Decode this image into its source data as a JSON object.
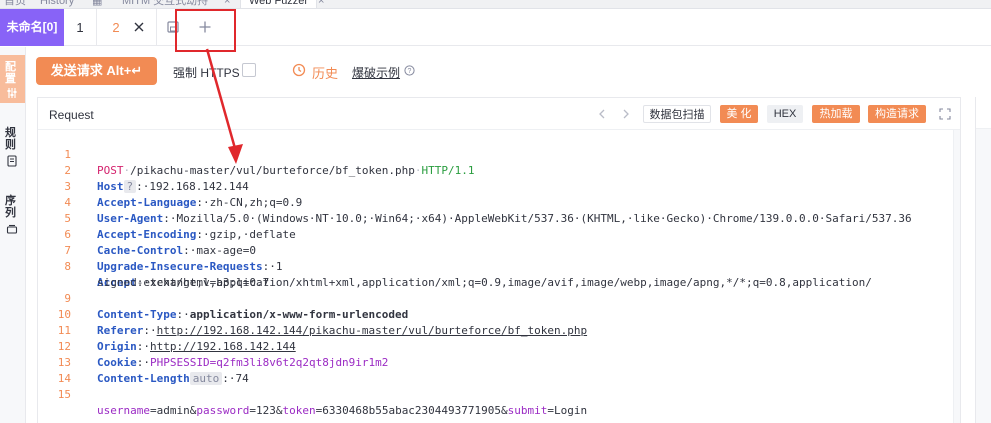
{
  "top_tabs": [
    {
      "label": "首页"
    },
    {
      "label": "History"
    },
    {
      "label": "MITM 交互式劫持"
    },
    {
      "label": "Web Fuzzer"
    }
  ],
  "tab_group": {
    "name": "未命名[0]",
    "tabs": [
      {
        "label": "1"
      },
      {
        "label": "2"
      }
    ]
  },
  "sidebar": {
    "items": [
      {
        "label": "配置"
      },
      {
        "label": "规则"
      },
      {
        "label": "序列"
      }
    ]
  },
  "toolbar": {
    "send_label": "发送请求 Alt+↵",
    "force_https_label": "强制 HTTPS",
    "history_label": "历史",
    "example_label": "爆破示例"
  },
  "request_panel": {
    "title": "Request",
    "buttons": {
      "scan": "数据包扫描",
      "beautify": "美 化",
      "hex": "HEX",
      "hot_load": "热加载",
      "build": "构造请求"
    }
  },
  "code": {
    "l1": {
      "num": "1",
      "method": "POST",
      "path": "/pikachu-master/vul/burteforce/bf_token.php",
      "proto": "HTTP/1.1"
    },
    "l2": {
      "num": "2",
      "name": "Host",
      "chip": "?",
      "value": "192.168.142.144"
    },
    "l3": {
      "num": "3",
      "name": "Accept-Language",
      "value": "zh-CN,zh;q=0.9"
    },
    "l4": {
      "num": "4",
      "name": "User-Agent",
      "value": "Mozilla/5.0·(Windows·NT·10.0;·Win64;·x64)·AppleWebKit/537.36·(KHTML,·like·Gecko)·Chrome/139.0.0.0·Safari/537.36"
    },
    "l5": {
      "num": "5",
      "name": "Accept-Encoding",
      "value": "gzip,·deflate"
    },
    "l6": {
      "num": "6",
      "name": "Cache-Control",
      "value": "max-age=0"
    },
    "l7": {
      "num": "7",
      "name": "Upgrade-Insecure-Requests",
      "value": "1"
    },
    "l8": {
      "num": "8",
      "name": "Accept",
      "value": "text/html,application/xhtml+xml,application/xml;q=0.9,image/avif,image/webp,image/apng,*/*;q=0.8,application/",
      "cont": "signed-exchange;v=b3;q=0.7"
    },
    "l9": {
      "num": "9",
      "name": "Content-Type",
      "value": "application/x-www-form-urlencoded"
    },
    "l10": {
      "num": "10",
      "name": "Referer",
      "value": "http://192.168.142.144/pikachu-master/vul/burteforce/bf_token.php"
    },
    "l11": {
      "num": "11",
      "name": "Origin",
      "value": "http://192.168.142.144"
    },
    "l12": {
      "num": "12",
      "name": "Cookie",
      "key": "PHPSESSID",
      "value": "=q2fm3li8v6t2q2qt8jdn9ir1m2"
    },
    "l13": {
      "num": "13",
      "name": "Content-Length",
      "chip": "auto",
      "value": "74"
    },
    "l14": {
      "num": "14"
    },
    "l15": {
      "num": "15",
      "k1": "username",
      "v1": "admin",
      "k2": "password",
      "v2": "123",
      "k3": "token",
      "v3": "6330468b55abac2304493771905",
      "k4": "submit",
      "v4": "Login",
      "eq": "=",
      "amp": "&"
    }
  },
  "colors": {
    "accent": "#f28b54",
    "group_purple": "#8863f7",
    "annotation_red": "#e0282c"
  }
}
